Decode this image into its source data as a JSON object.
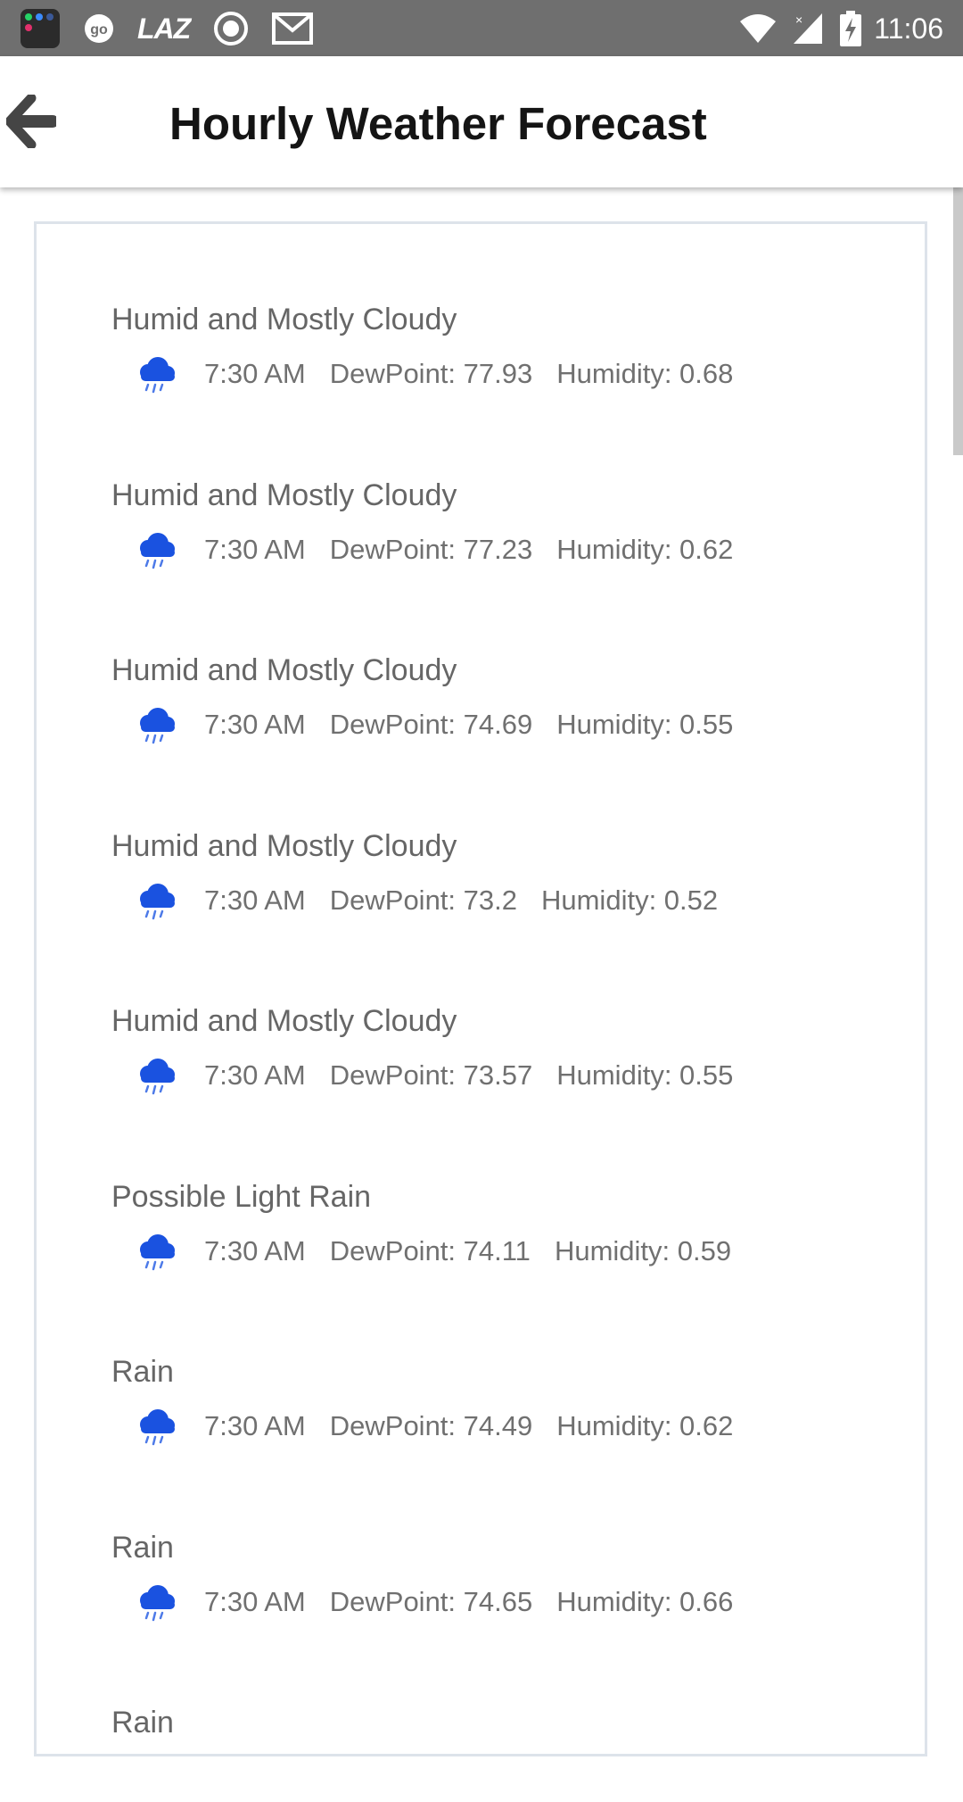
{
  "status_bar": {
    "time": "11:06",
    "notification_icons": [
      "app-folder-icon",
      "go-icon",
      "laz-icon",
      "record-icon",
      "gmail-icon"
    ],
    "laz_label": "LAZ",
    "go_label": "go",
    "system_icons": [
      "wifi-icon",
      "signal-icon",
      "battery-charging-icon"
    ]
  },
  "app_bar": {
    "title": "Hourly Weather Forecast",
    "back_icon": "arrow-left-icon"
  },
  "forecasts": [
    {
      "summary": "Humid and Mostly Cloudy",
      "time": "7:30 AM",
      "dew_point": "DewPoint: 77.93",
      "humidity": "Humidity: 0.68"
    },
    {
      "summary": "Humid and Mostly Cloudy",
      "time": "7:30 AM",
      "dew_point": "DewPoint: 77.23",
      "humidity": "Humidity: 0.62"
    },
    {
      "summary": "Humid and Mostly Cloudy",
      "time": "7:30 AM",
      "dew_point": "DewPoint: 74.69",
      "humidity": "Humidity: 0.55"
    },
    {
      "summary": "Humid and Mostly Cloudy",
      "time": "7:30 AM",
      "dew_point": "DewPoint: 73.2",
      "humidity": "Humidity: 0.52"
    },
    {
      "summary": "Humid and Mostly Cloudy",
      "time": "7:30 AM",
      "dew_point": "DewPoint: 73.57",
      "humidity": "Humidity: 0.55"
    },
    {
      "summary": "Possible Light Rain",
      "time": "7:30 AM",
      "dew_point": "DewPoint: 74.11",
      "humidity": "Humidity: 0.59"
    },
    {
      "summary": "Rain",
      "time": "7:30 AM",
      "dew_point": "DewPoint: 74.49",
      "humidity": "Humidity: 0.62"
    },
    {
      "summary": "Rain",
      "time": "7:30 AM",
      "dew_point": "DewPoint: 74.65",
      "humidity": "Humidity: 0.66"
    },
    {
      "summary": "Rain",
      "time": "",
      "dew_point": "",
      "humidity": ""
    }
  ],
  "weather_icon": "rain-cloud-icon",
  "colors": {
    "status_bar": "#6f6f6f",
    "icon_blue": "#1a52e0",
    "title_text": "#141414",
    "item_text": "#666666"
  }
}
